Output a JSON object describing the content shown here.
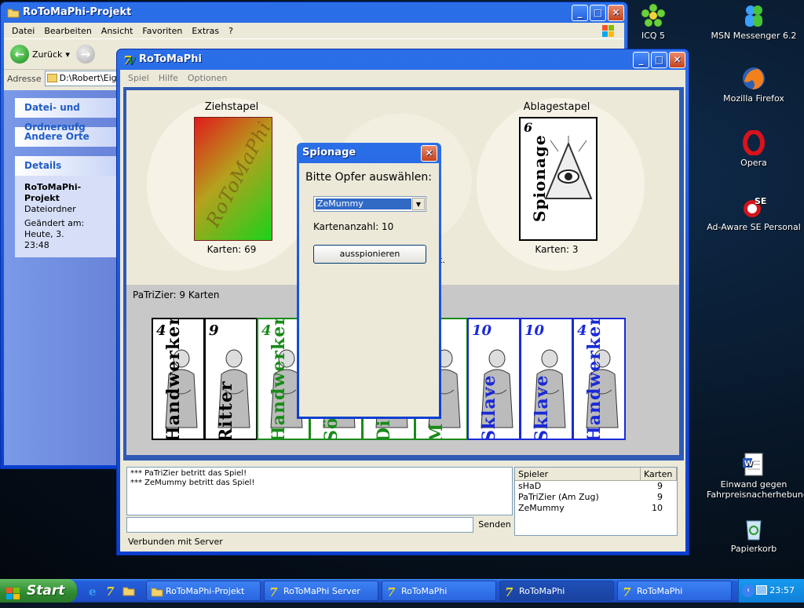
{
  "desktop": {
    "icons": [
      {
        "label": "ICQ 5"
      },
      {
        "label": "MSN Messenger 6.2"
      },
      {
        "label": "Mozilla Firefox"
      },
      {
        "label": "Opera"
      },
      {
        "label": "Ad-Aware SE Personal"
      },
      {
        "label": "Einwand gegen Fahrpreisnacherhebung"
      },
      {
        "label": "Papierkorb"
      }
    ]
  },
  "explorer": {
    "title": "RoToMaPhi-Projekt",
    "menu": [
      "Datei",
      "Bearbeiten",
      "Ansicht",
      "Favoriten",
      "Extras",
      "?"
    ],
    "back_label": "Zurück",
    "address_label": "Adresse",
    "address_value": "D:\\Robert\\Eige",
    "panels": {
      "tasks": "Datei- und Ordneraufg",
      "places": "Andere Orte",
      "details": "Details",
      "details_name": "RoToMaPhi-Projekt",
      "details_type": "Dateiordner",
      "details_changed": "Geändert am: Heute, 3.",
      "details_time": "23:48"
    }
  },
  "game": {
    "title": "RoToMaPhi",
    "menu": [
      "Spiel",
      "Hilfe",
      "Optionen"
    ],
    "stock": {
      "label": "Ziehstapel",
      "count_text": "Karten:  69",
      "logo_text": "RoToMaPhi"
    },
    "discard": {
      "label": "Ablagestapel",
      "count_text": "Karten:  3",
      "card_num": "6",
      "card_name": "Spionage"
    },
    "hidden_text": "t.",
    "hand_label": "PaTriZier: 9 Karten",
    "hand": [
      {
        "num": "4",
        "name": "Handwerker",
        "color": "#000000"
      },
      {
        "num": "9",
        "name": "Ritter",
        "color": "#000000"
      },
      {
        "num": "4",
        "name": "Handwerker",
        "color": "#1a8a1a"
      },
      {
        "num": "",
        "name": "Sö",
        "color": "#1a8a1a"
      },
      {
        "num": "",
        "name": "Di",
        "color": "#1a8a1a"
      },
      {
        "num": "",
        "name": "M",
        "color": "#1a8a1a"
      },
      {
        "num": "10",
        "name": "Sklave",
        "color": "#1a2ad6"
      },
      {
        "num": "10",
        "name": "Sklave",
        "color": "#1a2ad6"
      },
      {
        "num": "4",
        "name": "Handwerker",
        "color": "#1a2ad6"
      }
    ],
    "chat": [
      "*** PaTriZier betritt das Spiel!",
      "*** ZeMummy betritt das Spiel!"
    ],
    "send_label": "Senden",
    "players_header": {
      "name": "Spieler",
      "cards": "Karten"
    },
    "players": [
      {
        "name": "sHaD",
        "cards": "9"
      },
      {
        "name": "PaTriZier (Am Zug)",
        "cards": "9"
      },
      {
        "name": "ZeMummy",
        "cards": "10"
      }
    ],
    "status": "Verbunden mit Server"
  },
  "dialog": {
    "title": "Spionage",
    "question": "Bitte Opfer auswählen:",
    "selected": "ZeMummy",
    "count_text": "Kartenanzahl:  10",
    "button": "ausspionieren"
  },
  "taskbar": {
    "start": "Start",
    "tasks": [
      "RoToMaPhi-Projekt",
      "RoToMaPhi Server",
      "RoToMaPhi",
      "RoToMaPhi",
      "RoToMaPhi"
    ],
    "time": "23:57"
  }
}
